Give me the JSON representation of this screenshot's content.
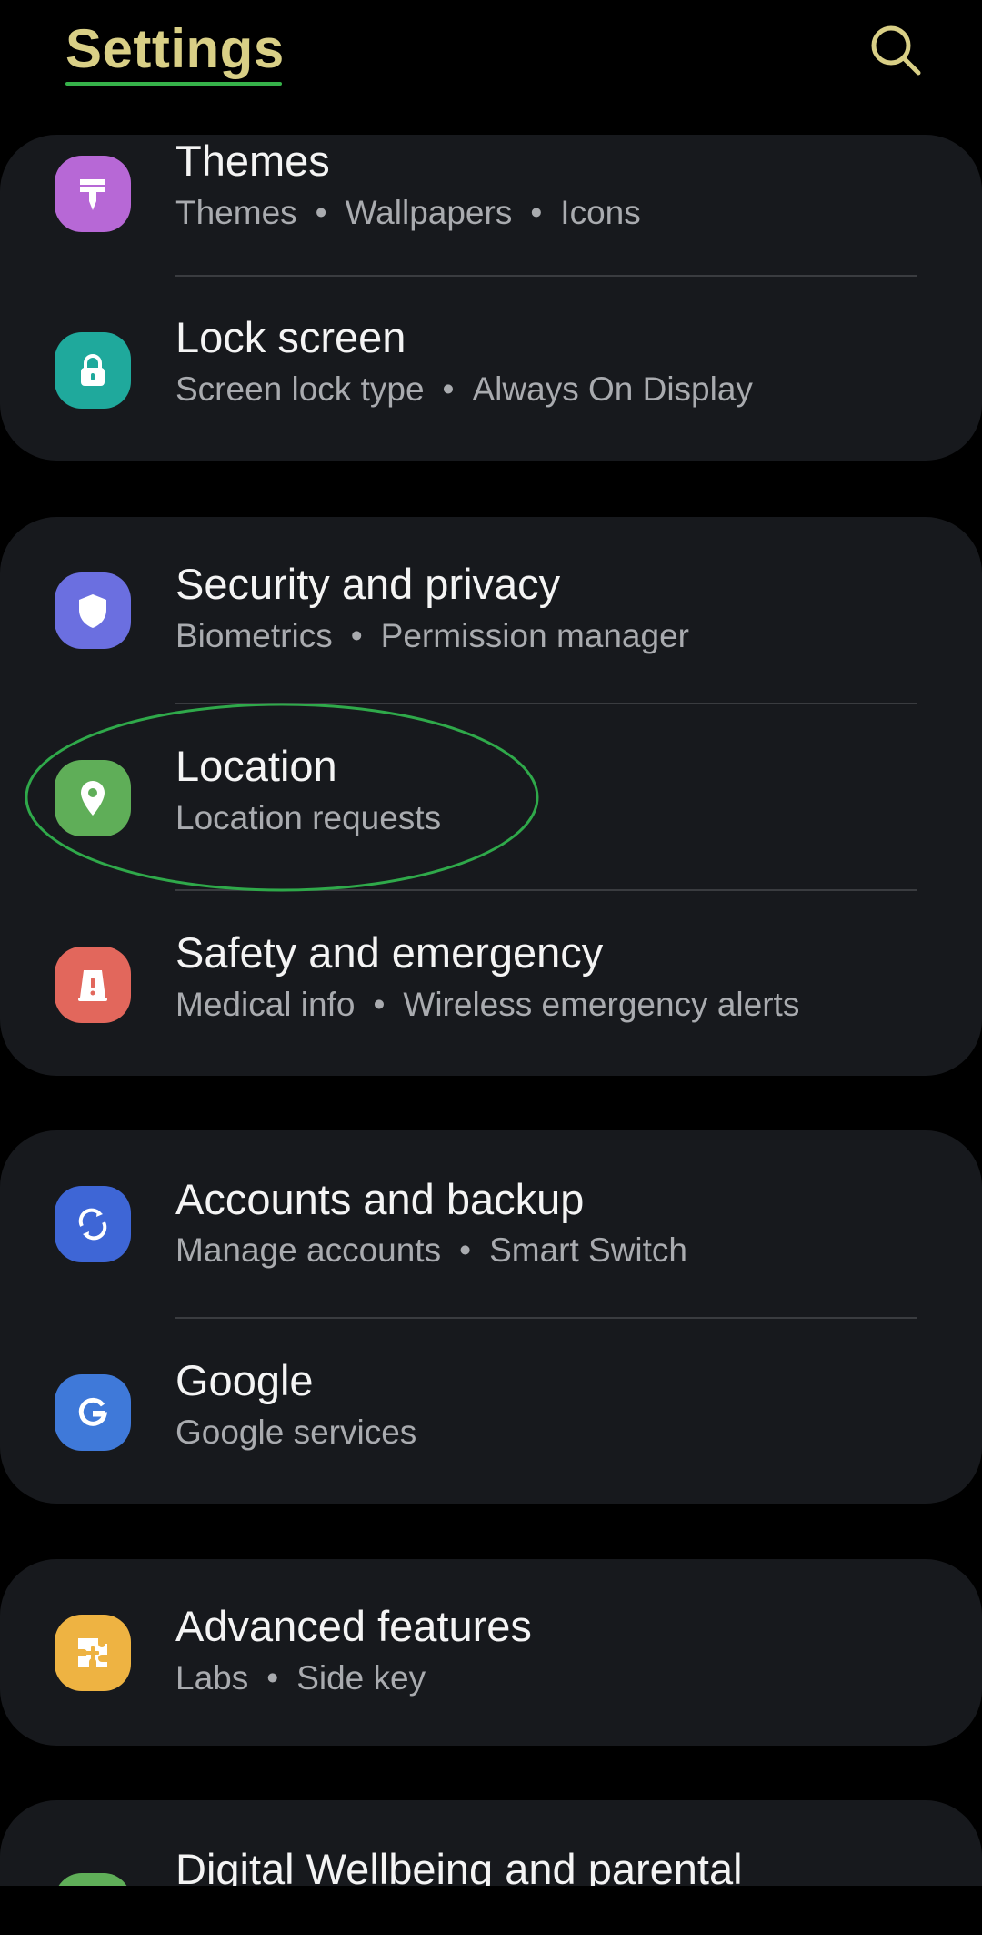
{
  "header": {
    "title": "Settings"
  },
  "icons": {
    "themes": "paint-brush-icon",
    "lock_screen": "lock-icon",
    "security": "shield-icon",
    "location": "location-pin-icon",
    "safety": "warning-icon",
    "accounts": "sync-icon",
    "google": "google-g-icon",
    "advanced": "puzzle-plus-icon",
    "search": "search-icon"
  },
  "colors": {
    "title": "#d9cf86",
    "title_underline": "#36b24a",
    "highlight_ellipse": "#2fa94a",
    "themes": "#b768d6",
    "lock_screen": "#1fa99c",
    "security": "#6b6fe0",
    "location": "#5fae58",
    "safety": "#e2675c",
    "accounts": "#3e66d6",
    "google": "#3f79d9",
    "advanced": "#eeb342"
  },
  "groups": [
    {
      "items": [
        {
          "title": "Themes",
          "subtitles": [
            "Themes",
            "Wallpapers",
            "Icons"
          ]
        },
        {
          "title": "Lock screen",
          "subtitles": [
            "Screen lock type",
            "Always On Display"
          ]
        }
      ]
    },
    {
      "items": [
        {
          "title": "Security and privacy",
          "subtitles": [
            "Biometrics",
            "Permission manager"
          ]
        },
        {
          "title": "Location",
          "subtitles": [
            "Location requests"
          ]
        },
        {
          "title": "Safety and emergency",
          "subtitles": [
            "Medical info",
            "Wireless emergency alerts"
          ]
        }
      ]
    },
    {
      "items": [
        {
          "title": "Accounts and backup",
          "subtitles": [
            "Manage accounts",
            "Smart Switch"
          ]
        },
        {
          "title": "Google",
          "subtitles": [
            "Google services"
          ]
        }
      ]
    },
    {
      "items": [
        {
          "title": "Advanced features",
          "subtitles": [
            "Labs",
            "Side key"
          ]
        }
      ]
    },
    {
      "items": [
        {
          "title": "Digital Wellbeing and parental"
        }
      ]
    }
  ]
}
